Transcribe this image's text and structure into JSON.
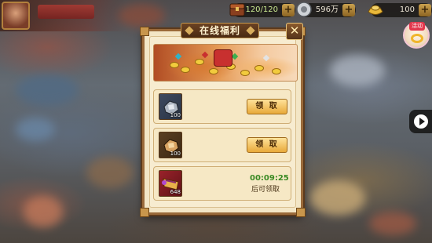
{
  "topbar": {
    "stamina": {
      "value": "120/120",
      "icon": "stamina-chest-icon"
    },
    "silver": {
      "value": "596万",
      "icon": "silver-coin-icon"
    },
    "gold": {
      "value": "100",
      "icon": "gold-ingot-icon"
    },
    "plus_label": "+"
  },
  "side": {
    "badge_tag": "活动",
    "play_icon": "play-icon"
  },
  "dialog": {
    "title": "在线福利",
    "close_label": "✕",
    "rewards": [
      {
        "icon": "silver-ingot-icon",
        "qty": "100",
        "action": "领 取",
        "color": "#4c5a70"
      },
      {
        "icon": "bronze-ingot-icon",
        "qty": "100",
        "action": "领 取",
        "color": "#6a4b2a"
      },
      {
        "icon": "scroll-icon",
        "qty": "648",
        "timer": "00:09:25",
        "timer_note": "后可领取",
        "color": "#8a1e24"
      }
    ]
  }
}
